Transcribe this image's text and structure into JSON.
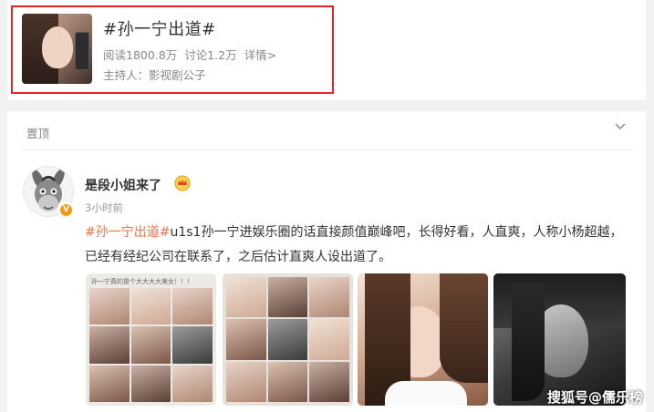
{
  "topic": {
    "title": "#孙一宁出道#",
    "read_stat": "阅读1800.8万",
    "discuss_stat": "讨论1.2万",
    "detail_link": "详情>",
    "host": "主持人：影视剧公子"
  },
  "post": {
    "pin_label": "置顶",
    "author": "是段小姐来了",
    "verified_badge": "V",
    "time": "3小时前",
    "hashtag": "#孙一宁出道#",
    "body": "u1s1孙一宁进娱乐圈的话直接颜值巅峰吧，长得好看，人直爽，人称小杨超越，已经有经纪公司在联系了，之后估计直爽人设出道了。",
    "photo_caption": "孙一宁真的是个大大大大美女！！！"
  },
  "watermark": "搜狐号@儒乐榜",
  "colors": {
    "highlight_border": "#e0242b",
    "hashtag": "#eb7350",
    "badge": "#f29a12"
  }
}
